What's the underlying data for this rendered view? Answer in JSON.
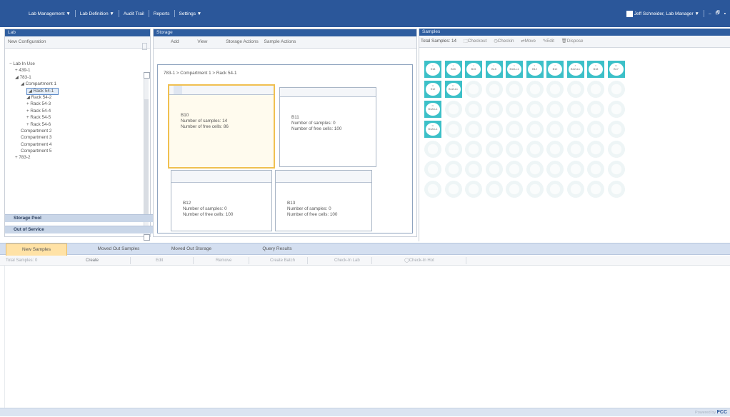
{
  "menu": {
    "items": [
      "Lab Management ▼",
      "Lab Definition ▼",
      "Audit Trail",
      "Reports",
      "Settings ▼"
    ],
    "user": "Jeff Schneider, Lab Manager ▼",
    "window_buttons": [
      "–",
      "🗗",
      "▪"
    ]
  },
  "lab_panel": {
    "title": "Lab",
    "config": "New Configuration",
    "tree": [
      {
        "text": "− Lab In Use",
        "indent": 0
      },
      {
        "text": "+ 439-1",
        "indent": 1
      },
      {
        "text": "◢ 783-1",
        "indent": 1
      },
      {
        "text": "◢ Compartment 1",
        "indent": 2
      },
      {
        "text": "◢ Rack 54-1",
        "indent": 3,
        "selected": true
      },
      {
        "text": "◢ Rack 54-2",
        "indent": 3
      },
      {
        "text": "+ Rack 54-3",
        "indent": 3
      },
      {
        "text": "+ Rack 54-4",
        "indent": 3
      },
      {
        "text": "+ Rack 54-5",
        "indent": 3
      },
      {
        "text": "+ Rack 54-6",
        "indent": 3
      },
      {
        "text": "Compartment 2",
        "indent": 2
      },
      {
        "text": "Compartment 3",
        "indent": 2
      },
      {
        "text": "Compartment 4",
        "indent": 2
      },
      {
        "text": "Compartment 5",
        "indent": 2
      },
      {
        "text": "+ 783-2",
        "indent": 1
      }
    ],
    "groups": [
      "Storage Pool",
      "Out of Service"
    ]
  },
  "storage_panel": {
    "title": "Storage",
    "toolbar": [
      "Add",
      "View",
      "Storage Actions",
      "Sample Actions"
    ],
    "breadcrumb": "783-1 > Compartment 1 > Rack 54-1",
    "racks": [
      {
        "name": "B10",
        "samples": "Number of samples: 14",
        "free": "Number of free cells: 86"
      },
      {
        "name": "B11",
        "samples": "Number of samples: 0",
        "free": "Number of free cells: 100"
      },
      {
        "name": "B12",
        "samples": "Number of samples: 0",
        "free": "Number of free cells: 100"
      },
      {
        "name": "B13",
        "samples": "Number of samples: 0",
        "free": "Number of free cells: 100"
      }
    ]
  },
  "samples_panel": {
    "title": "Samples",
    "total": "Total Samples: 14",
    "actions": [
      "Checkout",
      "Checkin",
      "Move",
      "Edit",
      "Dispose"
    ],
    "filled_cells": [
      {
        "num": "1",
        "label": "S18"
      },
      {
        "num": "2",
        "label": "B15"
      },
      {
        "num": "3",
        "label": "B15"
      },
      {
        "num": "4",
        "label": "B15"
      },
      {
        "num": "5",
        "label": "B12LL1"
      },
      {
        "num": "6",
        "label": "B12"
      },
      {
        "num": "7",
        "label": "B12"
      },
      {
        "num": "8",
        "label": "B12LL1"
      },
      {
        "num": "9",
        "label": "B18"
      },
      {
        "num": "10",
        "label": "B17"
      },
      {
        "num": "11",
        "label": "S12"
      },
      {
        "num": "12",
        "label": "B12LL1"
      },
      {
        "num": "21",
        "label": "B12LL1"
      },
      {
        "num": "31",
        "label": "B12LL1"
      }
    ]
  },
  "bottom_tabs": [
    "New Samples",
    "Moved Out Samples",
    "Moved Out Storage",
    "Query Results"
  ],
  "bottom_toolbar": [
    "Total Samples: 0",
    "Create",
    "Edit",
    "Remove",
    "Create Batch",
    "Check-In Lab",
    "Check-In Hot"
  ],
  "footer": {
    "text": "Powered by",
    "brand": "FCC"
  }
}
